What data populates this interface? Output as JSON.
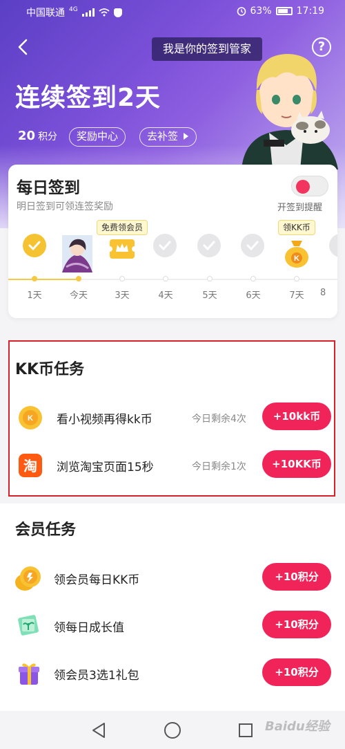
{
  "status_bar": {
    "carrier": "中国联通",
    "network": "4G",
    "battery": "63%",
    "time": "17:19"
  },
  "header": {
    "bubble": "我是你的签到管家",
    "streak_title": "连续签到2天",
    "points_value": "20",
    "points_unit": "积分",
    "reward_center": "奖励中心",
    "makeup_sign": "去补签"
  },
  "daily_sign": {
    "title": "每日签到",
    "subtitle": "明日签到可领连签奖励",
    "remind_label": "开签到提醒",
    "tags": {
      "free_vip": "免费领会员",
      "kk_coin": "领KK币"
    },
    "days": [
      {
        "label": "1天",
        "state": "done",
        "icon": "check-icon"
      },
      {
        "label": "今天",
        "state": "done",
        "icon": "character-avatar"
      },
      {
        "label": "3天",
        "state": "reward",
        "icon": "crown-ticket-icon"
      },
      {
        "label": "4天",
        "state": "pending",
        "icon": "check-icon"
      },
      {
        "label": "5天",
        "state": "pending",
        "icon": "check-icon"
      },
      {
        "label": "6天",
        "state": "pending",
        "icon": "check-icon"
      },
      {
        "label": "7天",
        "state": "reward",
        "icon": "coin-bag-icon"
      },
      {
        "label": "8",
        "state": "pending",
        "icon": "check-icon"
      }
    ]
  },
  "kk_tasks": {
    "title": "KK币任务",
    "items": [
      {
        "name": "看小视频再得kk币",
        "remaining": "今日剩余4次",
        "button": "+10kk币",
        "icon": "kk-coin-icon"
      },
      {
        "name": "浏览淘宝页面15秒",
        "remaining": "今日剩余1次",
        "button": "+10KK币",
        "icon": "taobao-icon"
      }
    ]
  },
  "member_tasks": {
    "title": "会员任务",
    "items": [
      {
        "name": "领会员每日KK币",
        "button": "+10积分",
        "icon": "coins-icon"
      },
      {
        "name": "领每日成长值",
        "button": "+10积分",
        "icon": "growth-icon"
      },
      {
        "name": "领会员3选1礼包",
        "button": "+10积分",
        "icon": "gift-icon"
      }
    ]
  },
  "colors": {
    "accent": "#f1245a",
    "gold": "#f5c332",
    "highlight_border": "#d8202b"
  },
  "watermark": "Baidu经验"
}
